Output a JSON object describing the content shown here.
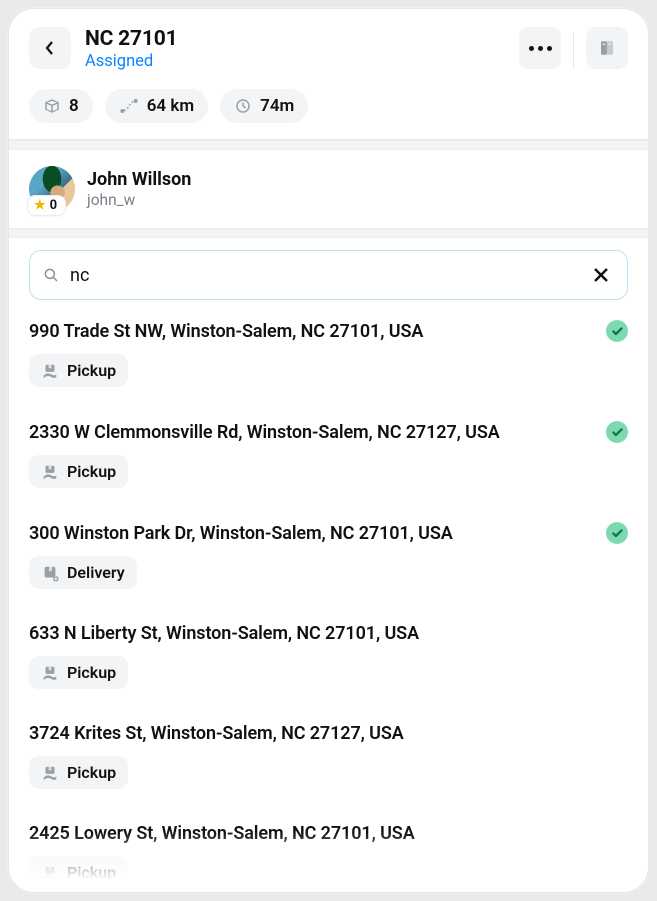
{
  "header": {
    "title": "NC 27101",
    "status": "Assigned"
  },
  "stats": {
    "packages": "8",
    "distance": "64 km",
    "duration": "74m"
  },
  "driver": {
    "name": "John Willson",
    "username": "john_w",
    "rating": "0"
  },
  "search": {
    "value": "nc",
    "placeholder": ""
  },
  "type_labels": {
    "pickup": "Pickup",
    "delivery": "Delivery"
  },
  "stops": [
    {
      "address": "990 Trade St NW, Winston-Salem, NC 27101, USA",
      "type": "pickup",
      "completed": true
    },
    {
      "address": "2330 W Clemmonsville Rd, Winston-Salem, NC 27127, USA",
      "type": "pickup",
      "completed": true
    },
    {
      "address": "300 Winston Park Dr, Winston-Salem, NC 27101, USA",
      "type": "delivery",
      "completed": true
    },
    {
      "address": "633 N Liberty St, Winston-Salem, NC 27101, USA",
      "type": "pickup",
      "completed": false
    },
    {
      "address": "3724 Krites St, Winston-Salem, NC 27127, USA",
      "type": "pickup",
      "completed": false
    },
    {
      "address": "2425 Lowery St, Winston-Salem, NC 27101, USA",
      "type": "pickup",
      "completed": false
    }
  ]
}
